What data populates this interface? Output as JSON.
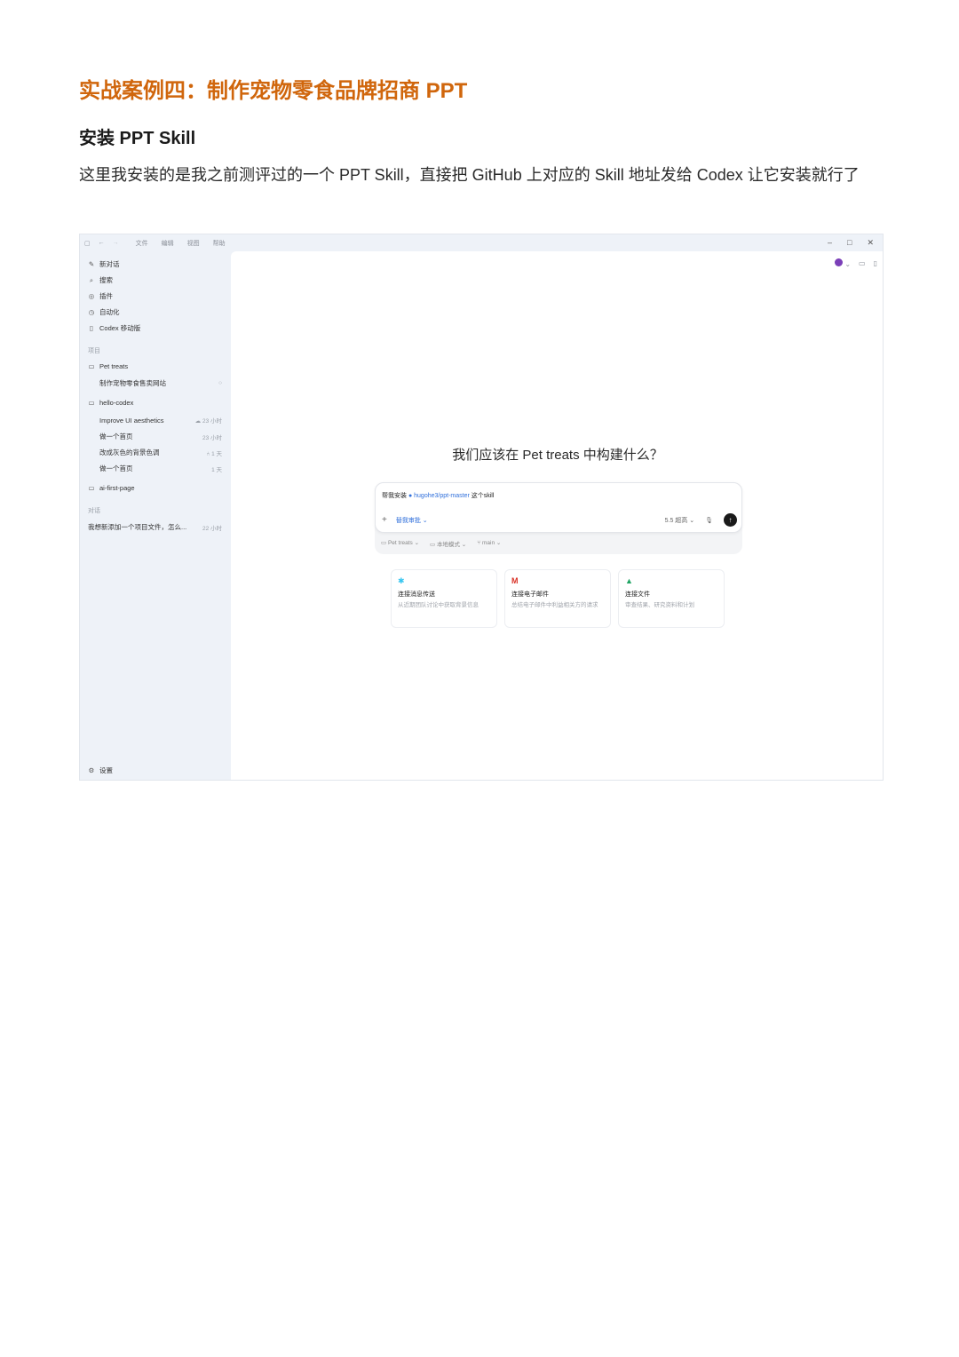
{
  "document": {
    "title": "实战案例四：制作宠物零食品牌招商 PPT",
    "subtitle": "安装 PPT Skill",
    "paragraph": "这里我安装的是我之前测评过的一个 PPT Skill，直接把 GitHub 上对应的 Skill 地址发给 Codex 让它安装就行了"
  },
  "app": {
    "titlebar": {
      "menu": [
        "文件",
        "编辑",
        "视图",
        "帮助"
      ]
    },
    "sidebar": {
      "nav": [
        {
          "label": "新对话",
          "icon": "edit-icon"
        },
        {
          "label": "搜索",
          "icon": "search-icon"
        },
        {
          "label": "插件",
          "icon": "plugin-icon"
        },
        {
          "label": "自动化",
          "icon": "clock-icon"
        },
        {
          "label": "Codex 移动版",
          "icon": "mobile-icon"
        }
      ],
      "projects_label": "项目",
      "projects": [
        {
          "name": "Pet treats",
          "tasks": [
            {
              "label": "制作宠物零食售卖网站",
              "meta": "○"
            }
          ]
        },
        {
          "name": "hello-codex",
          "tasks": [
            {
              "label": "Improve UI aesthetics",
              "meta": "☁ 23 小时"
            },
            {
              "label": "做一个首页",
              "meta": "23 小时"
            },
            {
              "label": "改成灰色的背景色调",
              "meta": "⑃ 1 天"
            },
            {
              "label": "做一个首页",
              "meta": "1 天"
            }
          ]
        },
        {
          "name": "ai-first-page",
          "tasks": []
        }
      ],
      "chats_label": "对话",
      "chats": [
        {
          "label": "我想新添加一个项目文件，怎么...",
          "meta": "22 小时"
        }
      ],
      "settings": "设置"
    },
    "main": {
      "heading": "我们应该在 Pet treats 中构建什么？",
      "composer": {
        "prompt_prefix": "帮我安装",
        "prompt_repo": "hugohe3/ppt-master",
        "prompt_suffix": "这个skill",
        "permission": "替我审批",
        "model": "5.5 超高",
        "footer": [
          "Pet treats",
          "本地模式",
          "main"
        ]
      },
      "cards": [
        {
          "icon": "slack-icon",
          "title": "连接消息传送",
          "desc": "从近期团队讨论中获取背景信息"
        },
        {
          "icon": "gmail-icon",
          "title": "连接电子邮件",
          "desc": "总结电子邮件中利益相关方的请求"
        },
        {
          "icon": "drive-icon",
          "title": "连接文件",
          "desc": "审查结果、研究资料和计划"
        }
      ]
    }
  }
}
